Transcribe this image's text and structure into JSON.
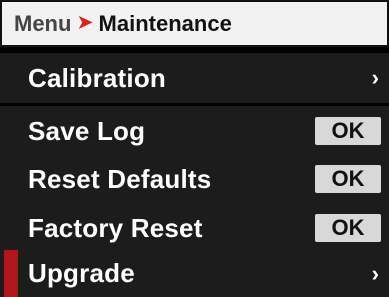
{
  "header": {
    "crumb_root": "Menu",
    "crumb_separator": "➤",
    "crumb_current": "Maintenance"
  },
  "menu": {
    "items": [
      {
        "label": "Calibration",
        "action": "chevron",
        "chevron_glyph": "›",
        "selected": false
      },
      {
        "label": "Save Log",
        "action": "button",
        "button_label": "OK",
        "selected": false
      },
      {
        "label": "Reset Defaults",
        "action": "button",
        "button_label": "OK",
        "selected": false
      },
      {
        "label": "Factory Reset",
        "action": "button",
        "button_label": "OK",
        "selected": false
      },
      {
        "label": "Upgrade",
        "action": "chevron",
        "chevron_glyph": "›",
        "selected": true
      }
    ]
  },
  "colors": {
    "background": "#000000",
    "header_bg": "#f2f2f2",
    "row_bg": "#1c1c1c",
    "accent_red": "#e0201b",
    "selection_bar": "#b1171a",
    "button_bg": "#d8d8d8",
    "text_light": "#ffffff",
    "text_dark": "#111111"
  },
  "icons": {
    "breadcrumb_separator": "arrow-right-icon",
    "submenu": "chevron-right-icon"
  }
}
